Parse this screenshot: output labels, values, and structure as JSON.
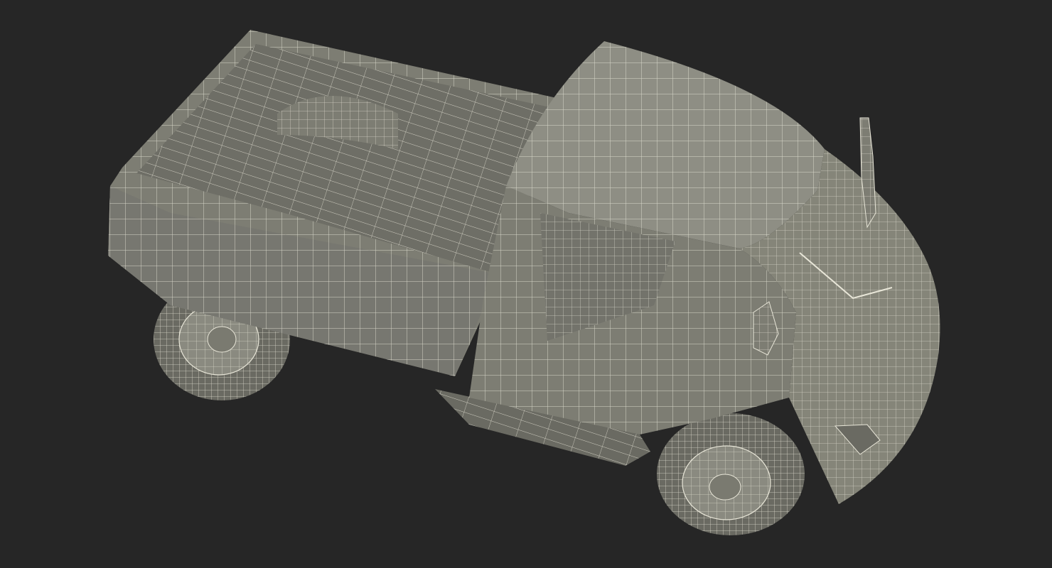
{
  "scene": {
    "subject": "pickup-truck-wireframe",
    "view": "top-three-quarter",
    "colors": {
      "background": "#262626",
      "surface": "#7d7d73",
      "surface_light": "#8e8e84",
      "surface_dark": "#5f5f57",
      "bed_floor": "#6e6e66",
      "wire": "#e8e6d8",
      "tire": "#6a6a62",
      "rim": "#8a8a80"
    },
    "icons": {
      "truck": "pickup-truck-icon"
    }
  }
}
